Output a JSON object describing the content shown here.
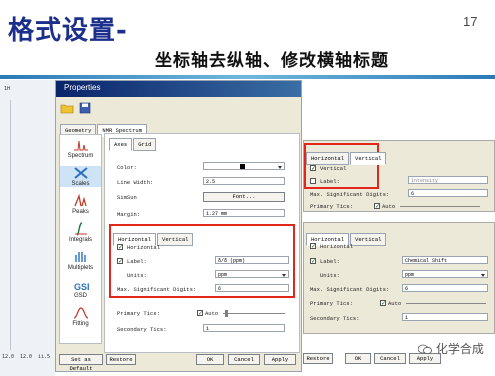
{
  "slide": {
    "title": "格式设置-",
    "page_number": "17",
    "subtitle": "坐标轴去纵轴、修改横轴标题"
  },
  "left_strip": {
    "top_label": "1H",
    "tick1": "12.0",
    "tick2": "12.0",
    "tick3": "ii.5"
  },
  "dialog": {
    "title": "Properties",
    "main_tabs": [
      "Geometry",
      "NMR Spectrum"
    ],
    "sub_tabs": [
      "Axes",
      "Grid"
    ],
    "nav": [
      {
        "label": "Spectrum",
        "icon": "spectrum-icon"
      },
      {
        "label": "Scales",
        "icon": "scales-icon"
      },
      {
        "label": "Peaks",
        "icon": "peaks-icon"
      },
      {
        "label": "Integrals",
        "icon": "integrals-icon"
      },
      {
        "label": "Multiplets",
        "icon": "multiplets-icon"
      },
      {
        "label": "GSD",
        "icon": "gsd-icon"
      },
      {
        "label": "Fitting",
        "icon": "fitting-icon"
      }
    ],
    "axes": {
      "color_label": "Color:",
      "line_width_label": "Line Width:",
      "line_width_value": "2.5",
      "simsun_label": "SimSun",
      "font_button": "Font...",
      "margin_label": "Margin:",
      "margin_value": "1.27 mm"
    },
    "inner_tabs": [
      "Horizontal",
      "Vertical"
    ],
    "horizontal": {
      "enable_label": "Horizontal",
      "label_label": "Label:",
      "label_value": "δ/δ (ppm)",
      "units_label": "Units:",
      "units_value": "ppm",
      "max_sig_label": "Max. Significant Digits:",
      "max_sig_value": "6",
      "primary_tics_label": "Primary Tics:",
      "auto_label": "Auto",
      "secondary_tics_label": "Secondary Tics:",
      "secondary_tics_value": "1"
    },
    "buttons": {
      "set_default": "Set as Default",
      "restore": "Restore",
      "ok": "OK",
      "cancel": "Cancel",
      "apply": "Apply"
    }
  },
  "snippet_vertical": {
    "tabs": [
      "Horizontal",
      "Vertical"
    ],
    "vertical_label": "Vertical",
    "label_label": "Label:",
    "label_value": "Intensity",
    "max_sig_label": "Max. Significant Digits:",
    "max_sig_value": "6",
    "primary_tics_label": "Primary Tics:",
    "auto_label": "Auto"
  },
  "snippet_horizontal": {
    "tabs": [
      "Horizontal",
      "Vertical"
    ],
    "horizontal_label": "Horizontal",
    "label_label": "Label:",
    "label_value": "Chemical Shift",
    "units_label": "Units:",
    "units_value": "ppm",
    "max_sig_label": "Max. Significant Digits:",
    "max_sig_value": "6",
    "primary_tics_label": "Primary Tics:",
    "auto_label": "Auto",
    "secondary_tics_label": "Secondary Tics:",
    "secondary_tics_value": "1"
  },
  "right_buttons": {
    "restore": "Restore",
    "ok": "OK",
    "cancel": "Cancel",
    "apply": "Apply"
  },
  "watermark": "化学合成",
  "colors": {
    "title_blue": "#1d2f8c",
    "highlight_red": "#e1261c",
    "dialog_bg": "#ece9d8"
  }
}
